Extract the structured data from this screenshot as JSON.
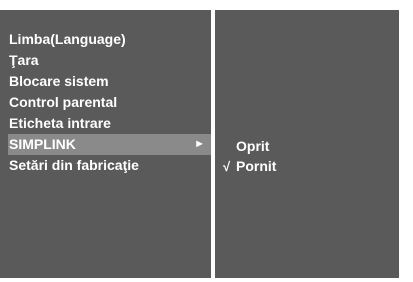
{
  "menu": {
    "items": [
      {
        "label": "Limba(Language)"
      },
      {
        "label": "Ţara"
      },
      {
        "label": "Blocare sistem"
      },
      {
        "label": "Control parental"
      },
      {
        "label": "Eticheta intrare"
      },
      {
        "label": "SIMPLINK",
        "selected": true,
        "arrow": "►"
      },
      {
        "label": "Setări din fabricaţie"
      }
    ]
  },
  "submenu": {
    "options": [
      {
        "label": "Oprit",
        "checked": false
      },
      {
        "label": "Pornit",
        "checked": true,
        "check_mark": "√"
      }
    ]
  },
  "colors": {
    "panel": "#5a5a5a",
    "highlight": "#8a8a8a",
    "text": "#ffffff"
  }
}
